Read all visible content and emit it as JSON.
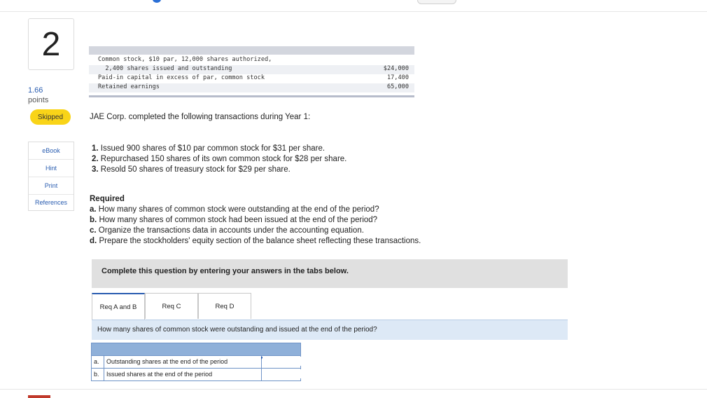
{
  "question": {
    "number": "2",
    "points_value": "1.66",
    "points_label": "points",
    "status": "Skipped"
  },
  "side_menu": [
    "eBook",
    "Hint",
    "Print",
    "References"
  ],
  "ledger": [
    {
      "name": "Common stock, $10 par, 12,000 shares authorized,",
      "amount": ""
    },
    {
      "name": "  2,400 shares issued and outstanding",
      "amount": "$24,000"
    },
    {
      "name": "Paid-in capital in excess of par, common stock",
      "amount": "17,400"
    },
    {
      "name": "Retained earnings",
      "amount": "65,000"
    }
  ],
  "intro": "JAE Corp. completed the following transactions during Year 1:",
  "transactions": [
    {
      "num": "1.",
      "text": "Issued 900 shares of $10 par common stock for $31 per share."
    },
    {
      "num": "2.",
      "text": "Repurchased 150 shares of its own common stock for $28 per share."
    },
    {
      "num": "3.",
      "text": "Resold 50 shares of treasury stock for $29 per share."
    }
  ],
  "required": {
    "heading": "Required",
    "items": [
      {
        "letter": "a.",
        "text": "How many shares of common stock were outstanding at the end of the period?"
      },
      {
        "letter": "b.",
        "text": "How many shares of common stock had been issued at the end of the period?"
      },
      {
        "letter": "c.",
        "text": "Organize the transactions data in accounts under the accounting equation."
      },
      {
        "letter": "d.",
        "text": "Prepare the stockholders' equity section of the balance sheet reflecting these transactions."
      }
    ]
  },
  "instructions": "Complete this question by entering your answers in the tabs below.",
  "tabs": [
    "Req A and B",
    "Req C",
    "Req D"
  ],
  "tab_question": "How many shares of common stock were outstanding and issued at the end of the period?",
  "answer_rows": [
    {
      "letter": "a.",
      "label": "Outstanding shares at the end of the period",
      "value": ""
    },
    {
      "letter": "b.",
      "label": "Issued shares at the end of the period",
      "value": ""
    }
  ],
  "colors": {
    "accent": "#2a5db0",
    "skipped": "#f9d418",
    "question_bar": "#dde9f6",
    "table_head": "#8fb0d9"
  }
}
